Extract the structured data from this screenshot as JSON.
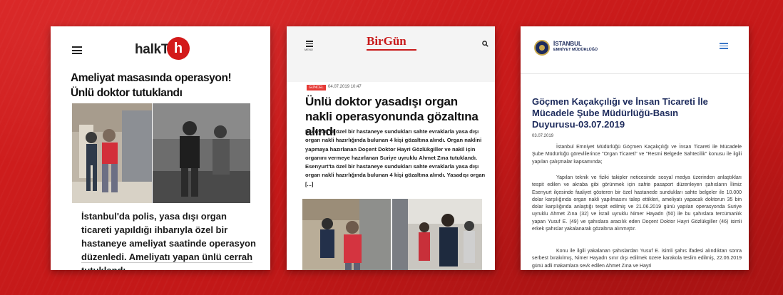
{
  "panel1": {
    "logo": {
      "text": "halkTV",
      "badge": "h"
    },
    "menu_icon": "hamburger-icon",
    "headline": "Ameliyat masasında operasyon! Ünlü doktor tutuklandı",
    "caption": "İstanbul'da polis, yasa dışı organ ticareti yapıldığı ihbarıyla özel bir hastaneye ameliyat saatinde operasyon düzenledi. Ameliyatı yapan ünlü cerrah tutuklandı."
  },
  "panel2": {
    "logo": "BirGün",
    "menu_label": "MENÜ",
    "category": "GÜNCEL",
    "date": "04.07.2019 10:47",
    "headline": "Ünlü doktor yasadışı organ nakli operasyonunda gözaltına alındı",
    "body": "Esenyurt'ta özel bir hastaneye sundukları sahte evraklarla yasa dışı organ nakli hazırlığında bulunan 4 kişi gözaltına alındı. Organ naklini yapmaya hazırlanan Doçent Doktor Hayri Gözlükgiller ve nakil için organını vermeye hazırlanan Suriye uyruklu Ahmet Zına tutuklandı. Esenyurt'ta özel bir hastaneye sundukları sahte evraklarla yasa dışı organ nakli hazırlığında bulunan 4 kişi gözaltına alındı. Yasadışı organ [...]"
  },
  "panel3": {
    "brand_line1": "İSTANBUL",
    "brand_line2": "EMNİYET MÜDÜRLÜĞÜ",
    "title": "Göçmen Kaçakçılığı ve İnsan Ticareti İle Mücadele Şube Müdürlüğü-Basın Duyurusu-03.07.2019",
    "date": "03.07.2019",
    "para1": "İstanbul Emniyet Müdürlüğü Göçmen Kaçakçılığı ve İnsan Ticareti ile Mücadele Şube Müdürlüğü görevlilerince \"Organ Ticareti\" ve \"Resmi Belgede Sahtecilik\" konusu ile ilgili yapılan çalışmalar kapsamında;",
    "para2": "Yapılan teknik ve fiziki takipler neticesinde sosyal medya üzerinden anlaştıkları tespit edilen ve akraba gibi görünmek için sahte pasaport düzenleyen şahısların İlimiz Esenyurt ilçesinde faaliyet gösteren bir özel hastanede sundukları sahte belgeler ile 10.000 dolar karşılığında organ nakli yapılmasını talep ettikleri, ameliyatı yapacak doktorun 35 bin dolar karşılığında anlaştığı tespit edilmiş ve 21.06.2019 günü yapılan operasyonda Suriye uyruklu Ahmet Zına (32) ve İsrail uyruklu Nimer Hayadrı (50) ile bu şahıslara tercümanlık yapan Yusuf E. (49) ve şahıslara aracılık eden Doçent Doktor Hayri Gözlükgiller (46) isimli erkek şahıslar yakalanarak gözaltına alınmıştır.",
    "para3": "Konu ile ilgili yakalanan şahıslardan Yusuf E. isimli şahıs ifadesi alındıktan sonra serbest bırakılmış, Nimer Hayadrı sınır dışı edilmek üzere karakola teslim edilmiş, 22.06.2019 günü adli makamlara sevk edilen Ahmet Zına ve Hayri"
  }
}
